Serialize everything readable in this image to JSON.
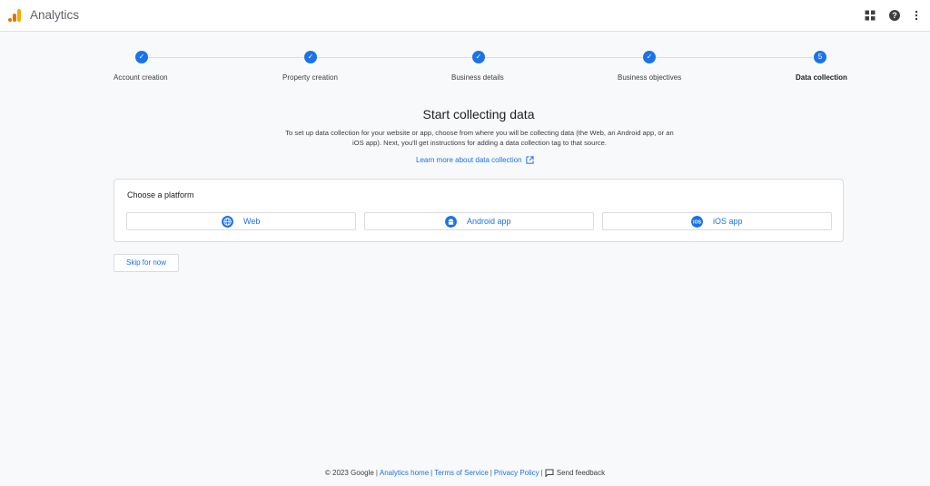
{
  "header": {
    "app_title": "Analytics",
    "icons": [
      "analytics-logo",
      "apps-grid-icon",
      "help-icon",
      "more-vert-icon"
    ]
  },
  "stepper": {
    "steps": [
      {
        "label": "Account creation",
        "state": "done",
        "marker": "✓"
      },
      {
        "label": "Property creation",
        "state": "done",
        "marker": "✓"
      },
      {
        "label": "Business details",
        "state": "done",
        "marker": "✓"
      },
      {
        "label": "Business objectives",
        "state": "done",
        "marker": "✓"
      },
      {
        "label": "Data collection",
        "state": "active",
        "marker": "5"
      }
    ]
  },
  "main": {
    "heading": "Start collecting data",
    "description": "To set up data collection for your website or app, choose from where you will be collecting data (the Web, an Android app, or an iOS app). Next, you'll get instructions for adding a data collection tag to that source.",
    "learn_more": "Learn more about data collection"
  },
  "platform_card": {
    "title": "Choose a platform",
    "options": [
      {
        "label": "Web",
        "icon": "globe-icon"
      },
      {
        "label": "Android app",
        "icon": "android-icon"
      },
      {
        "label": "iOS app",
        "icon": "ios-icon"
      }
    ]
  },
  "actions": {
    "skip_label": "Skip for now"
  },
  "footer": {
    "copyright": "© 2023 Google",
    "links": [
      "Analytics home",
      "Terms of Service",
      "Privacy Policy"
    ],
    "feedback": "Send feedback"
  },
  "colors": {
    "accent": "#1a73e8",
    "background": "#f8f9fa",
    "logo_orange": "#f9ab00",
    "logo_dark_orange": "#e37400"
  }
}
